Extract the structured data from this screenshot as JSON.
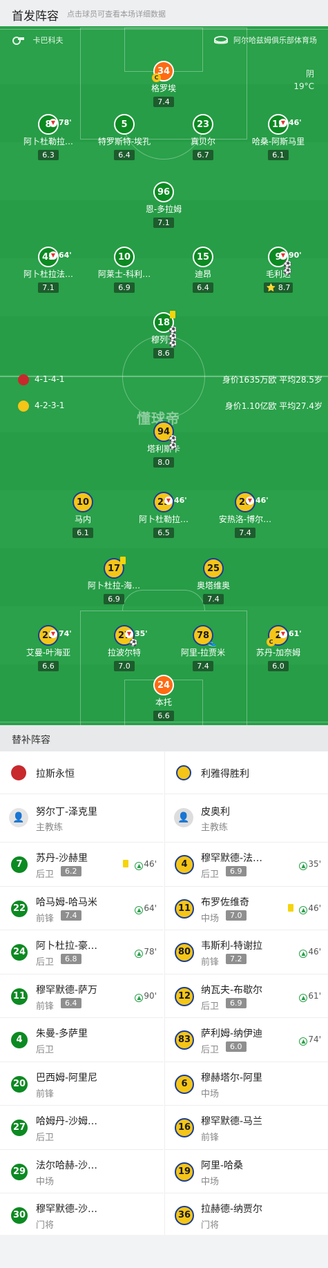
{
  "header": {
    "title": "首发阵容",
    "subtitle": "点击球员可查看本场详细数据"
  },
  "match_info": {
    "referee": "卡巴科夫",
    "venue": "阿尔哈兹姆俱乐部体育场",
    "weather": "阴",
    "temperature": "19°C"
  },
  "home": {
    "formation": "4-1-4-1",
    "value": "身价1635万欧 平均28.5岁",
    "badge_color": "#c8292d"
  },
  "away": {
    "formation": "4-2-3-1",
    "value": "身价1.10亿欧  平均27.4岁",
    "badge_color": "#f5c518"
  },
  "watermark": "懂球帝",
  "home_lineup": [
    {
      "number": "34",
      "name": "格罗埃",
      "rating": "7.4",
      "gk": true,
      "captain": true
    },
    {
      "number": "8",
      "name": "阿卜杜勒拉…",
      "rating": "6.3",
      "sub_minute": "78'"
    },
    {
      "number": "5",
      "name": "特罗斯特-埃孔",
      "rating": "6.4"
    },
    {
      "number": "23",
      "name": "真贝尔",
      "rating": "6.7"
    },
    {
      "number": "12",
      "name": "哈桑-阿斯马里",
      "rating": "6.1",
      "sub_minute": "46'"
    },
    {
      "number": "96",
      "name": "恩-多拉姆",
      "rating": "7.1"
    },
    {
      "number": "45",
      "name": "阿卜杜拉法…",
      "rating": "7.1",
      "sub_minute": "64'"
    },
    {
      "number": "10",
      "name": "阿莱士-科利…",
      "rating": "6.9"
    },
    {
      "number": "15",
      "name": "迪昂",
      "rating": "6.4"
    },
    {
      "number": "9",
      "name": "毛利达",
      "rating": "8.7",
      "sub_minute": "90'",
      "star": "⭐"
    },
    {
      "number": "18",
      "name": "穆列卡",
      "rating": "8.6"
    }
  ],
  "away_lineup": [
    {
      "number": "94",
      "name": "塔利斯卡",
      "rating": "8.0"
    },
    {
      "number": "10",
      "name": "马内",
      "rating": "6.1"
    },
    {
      "number": "29",
      "name": "阿卜杜勒拉…",
      "rating": "6.5",
      "sub_minute": "46'"
    },
    {
      "number": "20",
      "name": "安热洛-博尔…",
      "rating": "7.4",
      "sub_minute": "46'"
    },
    {
      "number": "17",
      "name": "阿卜杜拉-海…",
      "rating": "6.9"
    },
    {
      "number": "25",
      "name": "奥塔维奥",
      "rating": "7.4"
    },
    {
      "number": "23",
      "name": "艾曼-叶海亚",
      "rating": "6.6",
      "sub_minute": "74'"
    },
    {
      "number": "27",
      "name": "拉波尔特",
      "rating": "7.0",
      "sub_minute": "35'"
    },
    {
      "number": "78",
      "name": "阿里-拉贾米",
      "rating": "7.4"
    },
    {
      "number": "2",
      "name": "苏丹-加奈姆",
      "rating": "6.0",
      "sub_minute": "61'",
      "captain": true
    },
    {
      "number": "24",
      "name": "本托",
      "rating": "6.6",
      "gk": true
    }
  ],
  "subs_section": {
    "title": "替补阵容"
  },
  "home_team": {
    "name": "拉斯永恒",
    "coach": "努尔丁-泽克里",
    "coach_role": "主教练"
  },
  "away_team": {
    "name": "利雅得胜利",
    "coach": "皮奥利",
    "coach_role": "主教练"
  },
  "home_subs": [
    {
      "number": "7",
      "name": "苏丹-沙赫里",
      "position": "后卫",
      "rating": "6.2",
      "in": "46'",
      "yellow": true
    },
    {
      "number": "22",
      "name": "哈马姆-哈马米",
      "position": "前锋",
      "rating": "7.4",
      "in": "64'"
    },
    {
      "number": "24",
      "name": "阿卜杜拉-豪…",
      "position": "后卫",
      "rating": "6.8",
      "in": "78'"
    },
    {
      "number": "11",
      "name": "穆罕默德-萨万",
      "position": "前锋",
      "rating": "6.4",
      "in": "90'"
    },
    {
      "number": "4",
      "name": "朱曼-多萨里",
      "position": "后卫"
    },
    {
      "number": "20",
      "name": "巴西姆-阿里尼",
      "position": "前锋"
    },
    {
      "number": "27",
      "name": "哈姆丹-沙姆…",
      "position": "后卫"
    },
    {
      "number": "29",
      "name": "法尔哈赫-沙…",
      "position": "中场"
    },
    {
      "number": "30",
      "name": "穆罕默德-沙…",
      "position": "门将"
    }
  ],
  "away_subs": [
    {
      "number": "4",
      "name": "穆罕默德-法…",
      "position": "后卫",
      "rating": "6.9",
      "in": "35'"
    },
    {
      "number": "11",
      "name": "布罗佐维奇",
      "position": "中场",
      "rating": "7.0",
      "in": "46'",
      "yellow": true
    },
    {
      "number": "80",
      "name": "韦斯利-特谢拉",
      "position": "前锋",
      "rating": "7.2",
      "in": "46'"
    },
    {
      "number": "12",
      "name": "纳瓦夫-布歇尔",
      "position": "后卫",
      "rating": "6.9",
      "in": "61'"
    },
    {
      "number": "83",
      "name": "萨利姆-纳伊迪",
      "position": "后卫",
      "rating": "6.0",
      "in": "74'"
    },
    {
      "number": "6",
      "name": "穆赫塔尔-阿里",
      "position": "中场"
    },
    {
      "number": "16",
      "name": "穆罕默德-马兰",
      "position": "前锋"
    },
    {
      "number": "19",
      "name": "阿里-哈桑",
      "position": "中场"
    },
    {
      "number": "36",
      "name": "拉赫德-纳贾尔",
      "position": "门将"
    }
  ]
}
